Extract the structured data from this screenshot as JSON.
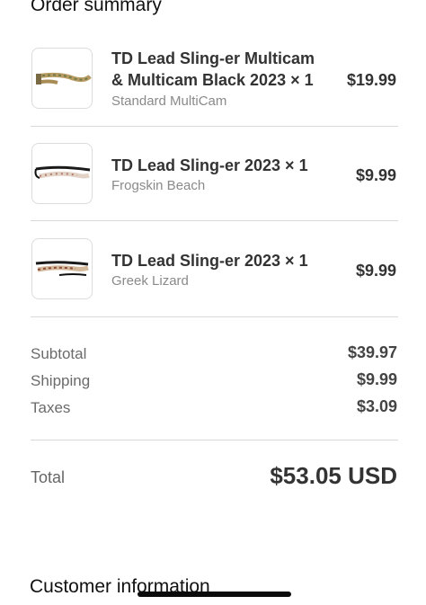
{
  "order_summary": {
    "title": "Order summary"
  },
  "items": [
    {
      "title_line1": "TD Lead Sling-er Multicam",
      "title_line2": "& Multicam Black 2023 × 1",
      "variant": "Standard MultiCam",
      "price": "$19.99"
    },
    {
      "title_line1": "TD Lead Sling-er 2023 × 1",
      "variant": "Frogskin Beach",
      "price": "$9.99"
    },
    {
      "title_line1": "TD Lead Sling-er 2023 × 1",
      "variant": "Greek Lizard",
      "price": "$9.99"
    }
  ],
  "summary": {
    "subtotal_label": "Subtotal",
    "subtotal_value": "$39.97",
    "shipping_label": "Shipping",
    "shipping_value": "$9.99",
    "taxes_label": "Taxes",
    "taxes_value": "$3.09"
  },
  "total": {
    "label": "Total",
    "value": "$53.05 USD"
  },
  "customer_information": {
    "title": "Customer information"
  }
}
